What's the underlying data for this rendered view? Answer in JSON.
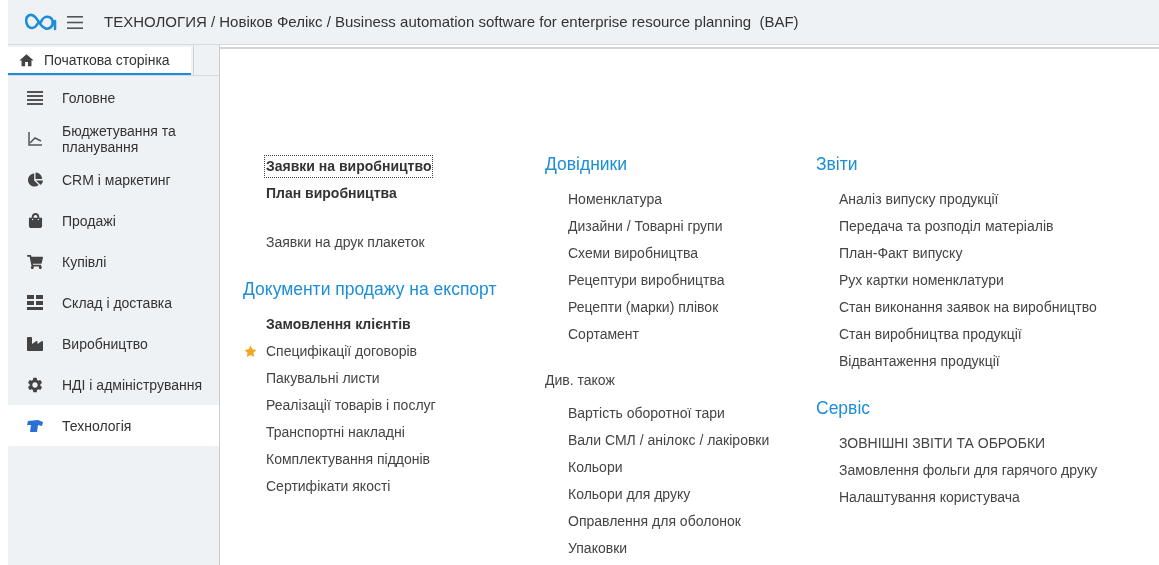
{
  "header": {
    "title": "ТЕХНОЛОГИЯ / Новіков Фелікс / Business automation software for enterprise resource planning  (BAF)"
  },
  "home_tab": {
    "label": "Початкова сторінка",
    "selected": true
  },
  "sidebar": {
    "items": [
      {
        "label": "Головне",
        "selected": false
      },
      {
        "label": "Бюджетування та планування",
        "selected": false
      },
      {
        "label": "CRM і маркетинг",
        "selected": false
      },
      {
        "label": "Продажі",
        "selected": false
      },
      {
        "label": "Купівлі",
        "selected": false
      },
      {
        "label": "Склад і доставка",
        "selected": false
      },
      {
        "label": "Виробництво",
        "selected": false
      },
      {
        "label": "НДІ і адміністрування",
        "selected": false
      },
      {
        "label": "Технологія",
        "selected": true
      }
    ]
  },
  "columns": [
    {
      "sections": [
        {
          "items": [
            {
              "text": "Заявки на виробництво",
              "important": true,
              "favorite": false,
              "focused": true
            },
            {
              "text": "План виробництва",
              "important": true,
              "favorite": false,
              "focused": false
            }
          ]
        },
        {
          "items": [
            {
              "text": "Заявки на друк плакеток",
              "important": false,
              "favorite": false,
              "focused": false
            }
          ]
        },
        {
          "title": "Документи продажу на експорт",
          "kind": "heading",
          "items": [
            {
              "text": "Замовлення клієнтів",
              "important": true,
              "favorite": false,
              "focused": false
            },
            {
              "text": "Специфікації договорів",
              "important": false,
              "favorite": true,
              "focused": false
            },
            {
              "text": "Пакувальні листи",
              "important": false,
              "favorite": false,
              "focused": false
            },
            {
              "text": "Реалізації товарів і послуг",
              "important": false,
              "favorite": false,
              "focused": false
            },
            {
              "text": "Транспортні накладні",
              "important": false,
              "favorite": false,
              "focused": false
            },
            {
              "text": "Комплектування піддонів",
              "important": false,
              "favorite": false,
              "focused": false
            },
            {
              "text": "Сертифікати якості",
              "important": false,
              "favorite": false,
              "focused": false
            }
          ]
        }
      ]
    },
    {
      "sections": [
        {
          "title": "Довідники",
          "kind": "heading",
          "items": [
            {
              "text": "Номенклатура",
              "important": false,
              "favorite": false,
              "focused": false
            },
            {
              "text": "Дизайни / Товарні групи",
              "important": false,
              "favorite": false,
              "focused": false
            },
            {
              "text": "Схеми виробництва",
              "important": false,
              "favorite": false,
              "focused": false
            },
            {
              "text": "Рецептури виробництва",
              "important": false,
              "favorite": false,
              "focused": false
            },
            {
              "text": "Рецепти (марки) плівок",
              "important": false,
              "favorite": false,
              "focused": false
            },
            {
              "text": "Сортамент",
              "important": false,
              "favorite": false,
              "focused": false
            }
          ]
        },
        {
          "title": "Див. також",
          "kind": "minor",
          "items": [
            {
              "text": "Вартість оборотної тари",
              "important": false,
              "favorite": false,
              "focused": false
            },
            {
              "text": "Вали СМЛ / анілокс / лакіровки",
              "important": false,
              "favorite": false,
              "focused": false
            },
            {
              "text": "Кольори",
              "important": false,
              "favorite": false,
              "focused": false
            },
            {
              "text": "Кольори для друку",
              "important": false,
              "favorite": false,
              "focused": false
            },
            {
              "text": "Оправлення для оболонок",
              "important": false,
              "favorite": false,
              "focused": false
            },
            {
              "text": "Упаковки",
              "important": false,
              "favorite": false,
              "focused": false
            }
          ]
        }
      ]
    },
    {
      "sections": [
        {
          "title": "Звіти",
          "kind": "heading",
          "items": [
            {
              "text": "Аналіз випуску продукції",
              "important": false,
              "favorite": false,
              "focused": false
            },
            {
              "text": "Передача та розподіл матеріалів",
              "important": false,
              "favorite": false,
              "focused": false
            },
            {
              "text": "План-Факт випуску",
              "important": false,
              "favorite": false,
              "focused": false
            },
            {
              "text": "Рух картки номенклатури",
              "important": false,
              "favorite": false,
              "focused": false
            },
            {
              "text": "Стан виконання заявок на виробництво",
              "important": false,
              "favorite": false,
              "focused": false
            },
            {
              "text": "Стан виробництва продукції",
              "important": false,
              "favorite": false,
              "focused": false
            },
            {
              "text": "Відвантаження продукції",
              "important": false,
              "favorite": false,
              "focused": false
            }
          ]
        },
        {
          "title": "Сервіс",
          "kind": "heading",
          "items": [
            {
              "text": "ЗОВНІШНІ ЗВІТИ ТА ОБРОБКИ",
              "important": false,
              "favorite": false,
              "focused": false
            },
            {
              "text": "Замовлення фольги для гарячого друку",
              "important": false,
              "favorite": false,
              "focused": false
            },
            {
              "text": "Налаштування користувача",
              "important": false,
              "favorite": false,
              "focused": false
            }
          ]
        }
      ]
    }
  ]
}
